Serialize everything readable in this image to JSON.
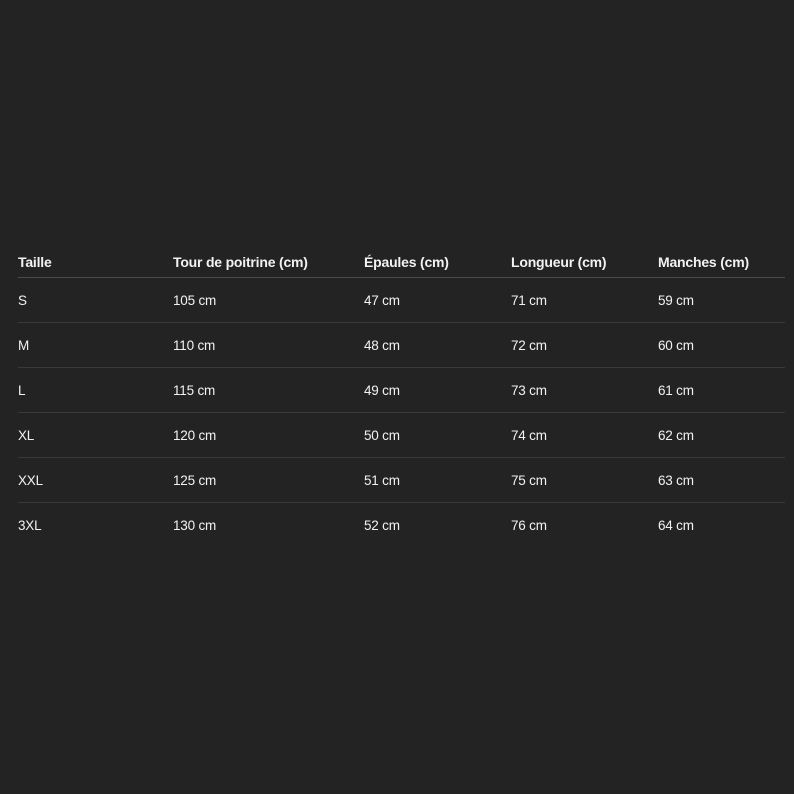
{
  "table": {
    "headers": [
      "Taille",
      "Tour de poitrine (cm)",
      "Épaules (cm)",
      "Longueur (cm)",
      "Manches (cm)"
    ],
    "rows": [
      [
        "S",
        "105 cm",
        "47 cm",
        "71 cm",
        "59 cm"
      ],
      [
        "M",
        "110 cm",
        "48 cm",
        "72 cm",
        "60 cm"
      ],
      [
        "L",
        "115 cm",
        "49 cm",
        "73 cm",
        "61 cm"
      ],
      [
        "XL",
        "120 cm",
        "50 cm",
        "74 cm",
        "62 cm"
      ],
      [
        "XXL",
        "125 cm",
        "51 cm",
        "75 cm",
        "63 cm"
      ],
      [
        "3XL",
        "130 cm",
        "52 cm",
        "76 cm",
        "64 cm"
      ]
    ]
  }
}
